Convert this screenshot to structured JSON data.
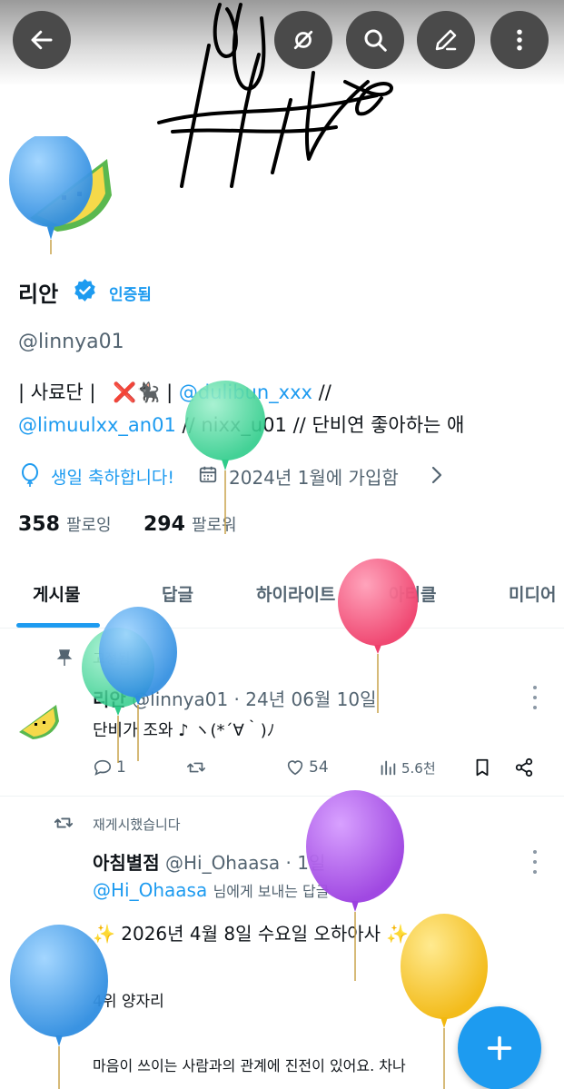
{
  "profile": {
    "name": "리안",
    "verified_label": "인증됨",
    "handle": "@linnya01",
    "bio": {
      "line1_prefix": "| 사료단 |",
      "line1_emoji": "❌🐈‍⬛",
      "line1_sep": "|",
      "line1_mention": "@dulibun_xxx",
      "line1_suffix": "//",
      "line2_mention": "@limuulxx_an01",
      "line2_sep": "//",
      "line2_text": "nixx_u01",
      "line2_sep2": "//",
      "line2_suffix": "단비연 좋아하는 애"
    },
    "birthday": "생일 축하합니다!",
    "joined": "2024년 1월에 가입함",
    "following_count": "358",
    "following_label": "팔로잉",
    "followers_count": "294",
    "followers_label": "팔로워"
  },
  "tabs": [
    "게시물",
    "답글",
    "하이라이트",
    "아티클",
    "미디어"
  ],
  "posts": [
    {
      "context": "고정됨",
      "author": "리안",
      "handle": "@linnya01",
      "dot": "·",
      "date": "24년 06월 10일",
      "text": "단비가 조와 ♪ ヽ(*´∀｀)ﾉ",
      "replies": "1",
      "likes": "54",
      "views": "5.6천"
    },
    {
      "context": "재게시했습니다",
      "author": "아침별점",
      "handle": "@Hi_Ohaasa",
      "dot": "·",
      "date": "1일",
      "reply_to_mention": "@Hi_Ohaasa",
      "reply_to_suffix": "님에게 보내는 답글",
      "line1": "✨ 2026년 4월 8일 수요일 오하아사 ✨",
      "line2": "4위 양자리",
      "line3": "마음이 쓰이는 사람과의 관계에 진전이 있어요. 차나"
    }
  ],
  "colors": {
    "accent": "#1d9bf0",
    "text": "#0f1419",
    "muted": "#536471",
    "header_button": "#4a4a4a",
    "fab": "#1d9bf0"
  },
  "icons": {
    "back": "arrow-left-icon",
    "hide": "eye-off-icon",
    "search": "search-icon",
    "edit": "pencil-icon",
    "more": "more-vertical-icon",
    "verified": "verified-badge-icon",
    "balloon": "balloon-icon",
    "calendar": "calendar-icon",
    "pin": "pin-icon",
    "reply": "reply-icon",
    "repost": "repost-icon",
    "like": "heart-icon",
    "views": "bar-chart-icon",
    "bookmark": "bookmark-icon",
    "share": "share-icon",
    "compose": "plus-icon"
  }
}
